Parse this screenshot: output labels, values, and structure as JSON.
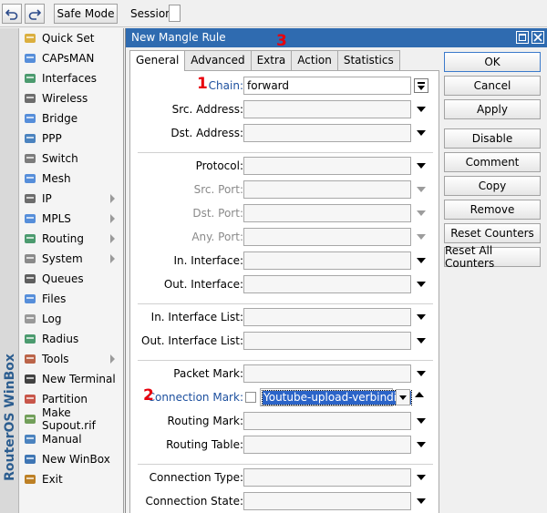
{
  "toolbar": {
    "undo_icon": "undo-icon",
    "redo_icon": "redo-icon",
    "safe_mode_label": "Safe Mode",
    "session_label": "Session:"
  },
  "brand": "RouterOS WinBox",
  "menu": {
    "items": [
      {
        "label": "Quick Set",
        "icon": "quick-set-icon",
        "submenu": false
      },
      {
        "label": "CAPsMAN",
        "icon": "capsman-icon",
        "submenu": false
      },
      {
        "label": "Interfaces",
        "icon": "interfaces-icon",
        "submenu": false
      },
      {
        "label": "Wireless",
        "icon": "wireless-icon",
        "submenu": false
      },
      {
        "label": "Bridge",
        "icon": "bridge-icon",
        "submenu": false
      },
      {
        "label": "PPP",
        "icon": "ppp-icon",
        "submenu": false
      },
      {
        "label": "Switch",
        "icon": "switch-icon",
        "submenu": false
      },
      {
        "label": "Mesh",
        "icon": "mesh-icon",
        "submenu": false
      },
      {
        "label": "IP",
        "icon": "ip-icon",
        "submenu": true
      },
      {
        "label": "MPLS",
        "icon": "mpls-icon",
        "submenu": true
      },
      {
        "label": "Routing",
        "icon": "routing-icon",
        "submenu": true
      },
      {
        "label": "System",
        "icon": "system-icon",
        "submenu": true
      },
      {
        "label": "Queues",
        "icon": "queues-icon",
        "submenu": false
      },
      {
        "label": "Files",
        "icon": "files-icon",
        "submenu": false
      },
      {
        "label": "Log",
        "icon": "log-icon",
        "submenu": false
      },
      {
        "label": "Radius",
        "icon": "radius-icon",
        "submenu": false
      },
      {
        "label": "Tools",
        "icon": "tools-icon",
        "submenu": true
      },
      {
        "label": "New Terminal",
        "icon": "terminal-icon",
        "submenu": false
      },
      {
        "label": "Partition",
        "icon": "partition-icon",
        "submenu": false
      },
      {
        "label": "Make Supout.rif",
        "icon": "supout-icon",
        "submenu": false
      },
      {
        "label": "Manual",
        "icon": "manual-icon",
        "submenu": false
      },
      {
        "label": "New WinBox",
        "icon": "winbox-icon",
        "submenu": false
      },
      {
        "label": "Exit",
        "icon": "exit-icon",
        "submenu": false
      }
    ]
  },
  "dialog": {
    "title": "New Mangle Rule",
    "tabs": [
      "General",
      "Advanced",
      "Extra",
      "Action",
      "Statistics"
    ],
    "active_tab": "General",
    "annotations": {
      "chain": "1",
      "connection_mark": "2",
      "action_tab": "3"
    },
    "fields": {
      "chain": {
        "label": "Chain:",
        "value": "forward"
      },
      "src_address": {
        "label": "Src. Address:",
        "value": ""
      },
      "dst_address": {
        "label": "Dst. Address:",
        "value": ""
      },
      "protocol": {
        "label": "Protocol:",
        "value": ""
      },
      "src_port": {
        "label": "Src. Port:",
        "value": ""
      },
      "dst_port": {
        "label": "Dst. Port:",
        "value": ""
      },
      "any_port": {
        "label": "Any. Port:",
        "value": ""
      },
      "in_interface": {
        "label": "In. Interface:",
        "value": ""
      },
      "out_interface": {
        "label": "Out. Interface:",
        "value": ""
      },
      "in_interface_list": {
        "label": "In. Interface List:",
        "value": ""
      },
      "out_interface_list": {
        "label": "Out. Interface List:",
        "value": ""
      },
      "packet_mark": {
        "label": "Packet Mark:",
        "value": ""
      },
      "connection_mark": {
        "label": "Connection Mark:",
        "value": "Youtube-upload-verbinding",
        "negate": false
      },
      "routing_mark": {
        "label": "Routing Mark:",
        "value": ""
      },
      "routing_table": {
        "label": "Routing Table:",
        "value": ""
      },
      "connection_type": {
        "label": "Connection Type:",
        "value": ""
      },
      "connection_state": {
        "label": "Connection State:",
        "value": ""
      }
    },
    "buttons": [
      "OK",
      "Cancel",
      "Apply",
      "Disable",
      "Comment",
      "Copy",
      "Remove",
      "Reset Counters",
      "Reset All Counters"
    ]
  },
  "colors": {
    "titlebar": "#2f6bb0",
    "annotation": "#e8000c",
    "selection": "#2b64c8",
    "label_blue": "#1c4f9e"
  }
}
